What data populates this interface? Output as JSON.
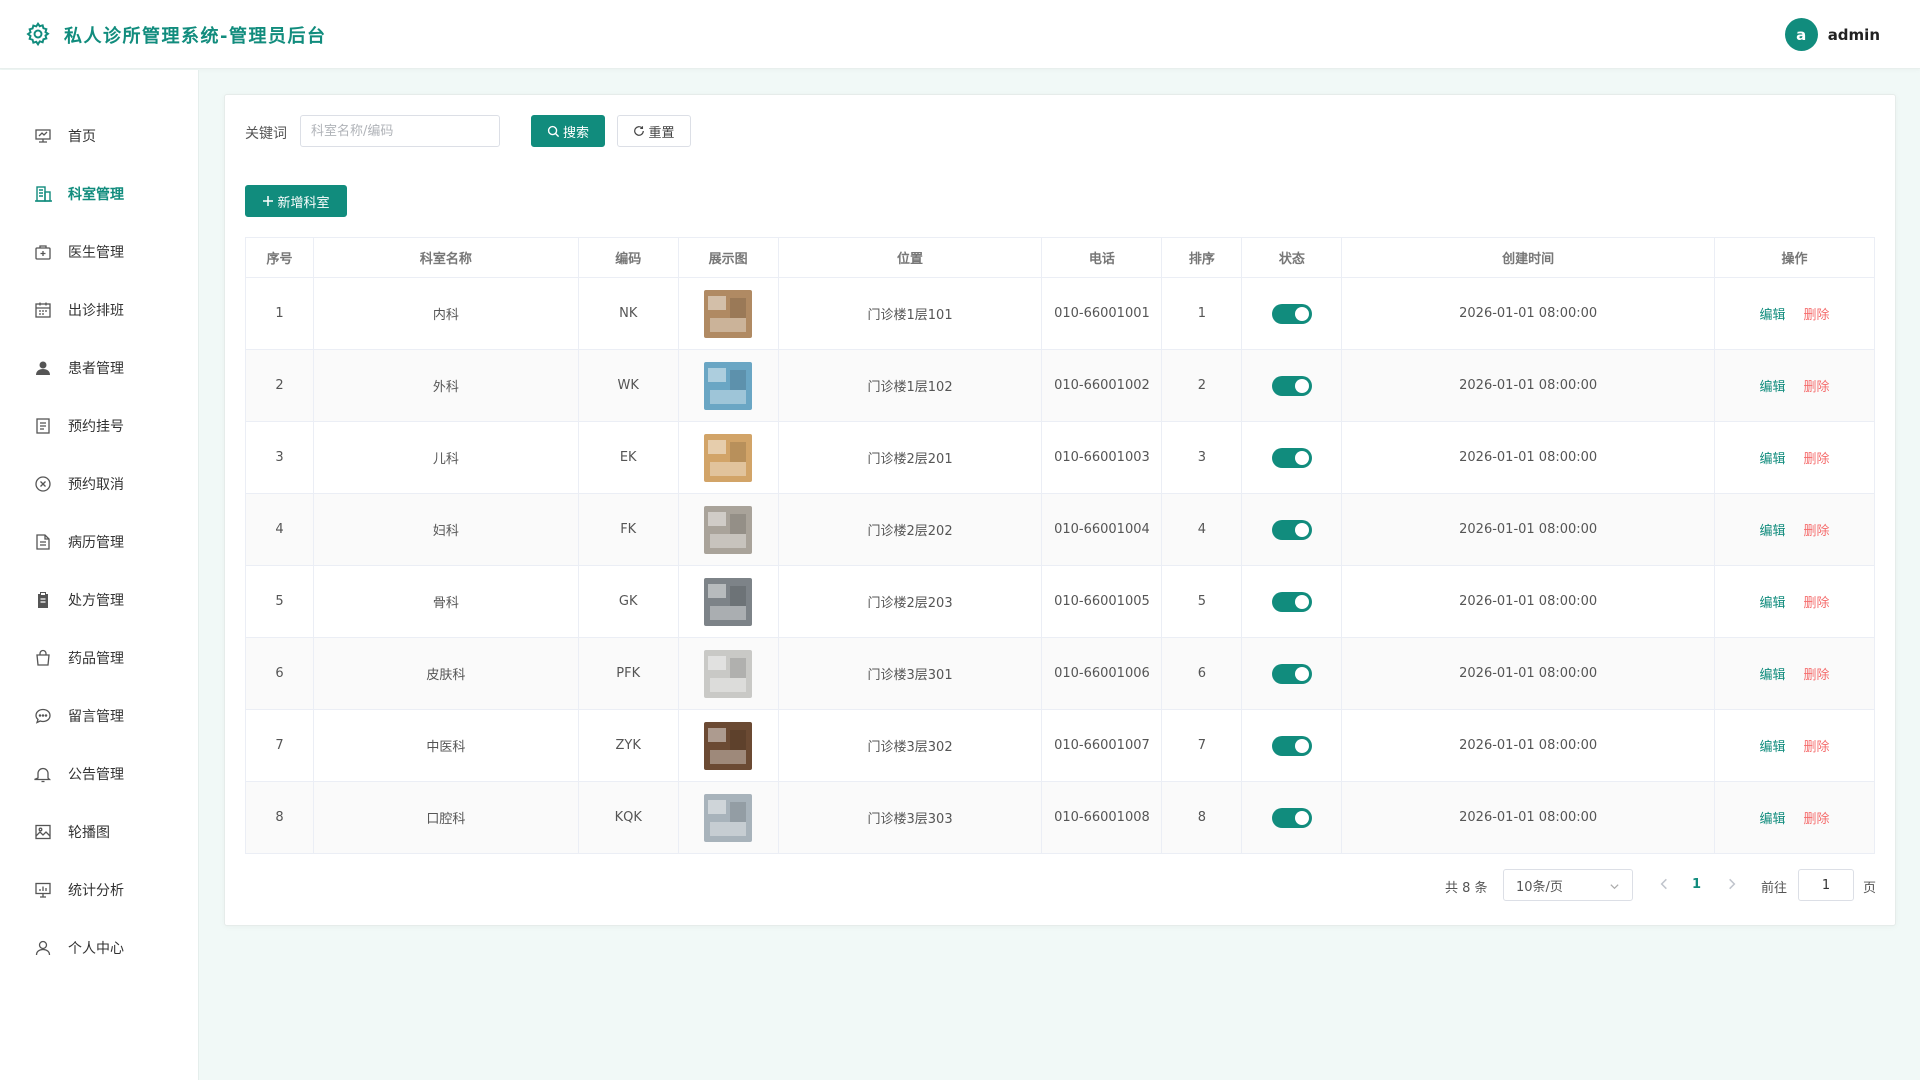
{
  "header": {
    "title": "私人诊所管理系统-管理员后台",
    "user": {
      "avatar_letter": "a",
      "name": "admin"
    }
  },
  "sidebar": {
    "items": [
      {
        "label": "首页",
        "icon": "dashboard-icon",
        "active": false
      },
      {
        "label": "科室管理",
        "icon": "building-icon",
        "active": true
      },
      {
        "label": "医生管理",
        "icon": "medical-kit-icon",
        "active": false
      },
      {
        "label": "出诊排班",
        "icon": "calendar-icon",
        "active": false
      },
      {
        "label": "患者管理",
        "icon": "user-filled-icon",
        "active": false
      },
      {
        "label": "预约挂号",
        "icon": "document-icon",
        "active": false
      },
      {
        "label": "预约取消",
        "icon": "circle-close-icon",
        "active": false
      },
      {
        "label": "病历管理",
        "icon": "document-text-icon",
        "active": false
      },
      {
        "label": "处方管理",
        "icon": "clipboard-icon",
        "active": false
      },
      {
        "label": "药品管理",
        "icon": "shopping-bag-icon",
        "active": false
      },
      {
        "label": "留言管理",
        "icon": "chat-icon",
        "active": false
      },
      {
        "label": "公告管理",
        "icon": "bell-icon",
        "active": false
      },
      {
        "label": "轮播图",
        "icon": "picture-icon",
        "active": false
      },
      {
        "label": "统计分析",
        "icon": "chart-icon",
        "active": false
      },
      {
        "label": "个人中心",
        "icon": "user-icon",
        "active": false
      }
    ]
  },
  "search": {
    "label": "关键词",
    "placeholder": "科室名称/编码",
    "value": "",
    "search_button": "搜索",
    "reset_button": "重置"
  },
  "add_button": "新增科室",
  "table": {
    "columns": [
      "序号",
      "科室名称",
      "编码",
      "展示图",
      "位置",
      "电话",
      "排序",
      "状态",
      "创建时间",
      "操作"
    ],
    "edit_label": "编辑",
    "delete_label": "删除",
    "rows": [
      {
        "index": "1",
        "name": "内科",
        "code": "NK",
        "location": "门诊楼1层101",
        "phone": "010-66001001",
        "sort": "1",
        "enabled": true,
        "created": "2026-01-01 08:00:00",
        "thumb_color": "#b08a63"
      },
      {
        "index": "2",
        "name": "外科",
        "code": "WK",
        "location": "门诊楼1层102",
        "phone": "010-66001002",
        "sort": "2",
        "enabled": true,
        "created": "2026-01-01 08:00:00",
        "thumb_color": "#6aa6c4"
      },
      {
        "index": "3",
        "name": "儿科",
        "code": "EK",
        "location": "门诊楼2层201",
        "phone": "010-66001003",
        "sort": "3",
        "enabled": true,
        "created": "2026-01-01 08:00:00",
        "thumb_color": "#d2a468"
      },
      {
        "index": "4",
        "name": "妇科",
        "code": "FK",
        "location": "门诊楼2层202",
        "phone": "010-66001004",
        "sort": "4",
        "enabled": true,
        "created": "2026-01-01 08:00:00",
        "thumb_color": "#a9a39a"
      },
      {
        "index": "5",
        "name": "骨科",
        "code": "GK",
        "location": "门诊楼2层203",
        "phone": "010-66001005",
        "sort": "5",
        "enabled": true,
        "created": "2026-01-01 08:00:00",
        "thumb_color": "#7d8388"
      },
      {
        "index": "6",
        "name": "皮肤科",
        "code": "PFK",
        "location": "门诊楼3层301",
        "phone": "010-66001006",
        "sort": "6",
        "enabled": true,
        "created": "2026-01-01 08:00:00",
        "thumb_color": "#c9c9c6"
      },
      {
        "index": "7",
        "name": "中医科",
        "code": "ZYK",
        "location": "门诊楼3层302",
        "phone": "010-66001007",
        "sort": "7",
        "enabled": true,
        "created": "2026-01-01 08:00:00",
        "thumb_color": "#6b4a33"
      },
      {
        "index": "8",
        "name": "口腔科",
        "code": "KQK",
        "location": "门诊楼3层303",
        "phone": "010-66001008",
        "sort": "8",
        "enabled": true,
        "created": "2026-01-01 08:00:00",
        "thumb_color": "#a8b3bb"
      }
    ]
  },
  "pagination": {
    "total_text": "共 8 条",
    "page_size": "10条/页",
    "current_page": "1",
    "goto_label": "前往",
    "goto_value": "1",
    "page_suffix": "页"
  },
  "colors": {
    "accent": "#118c7d",
    "danger": "#f56c6c",
    "background": "#f1f9f7"
  }
}
